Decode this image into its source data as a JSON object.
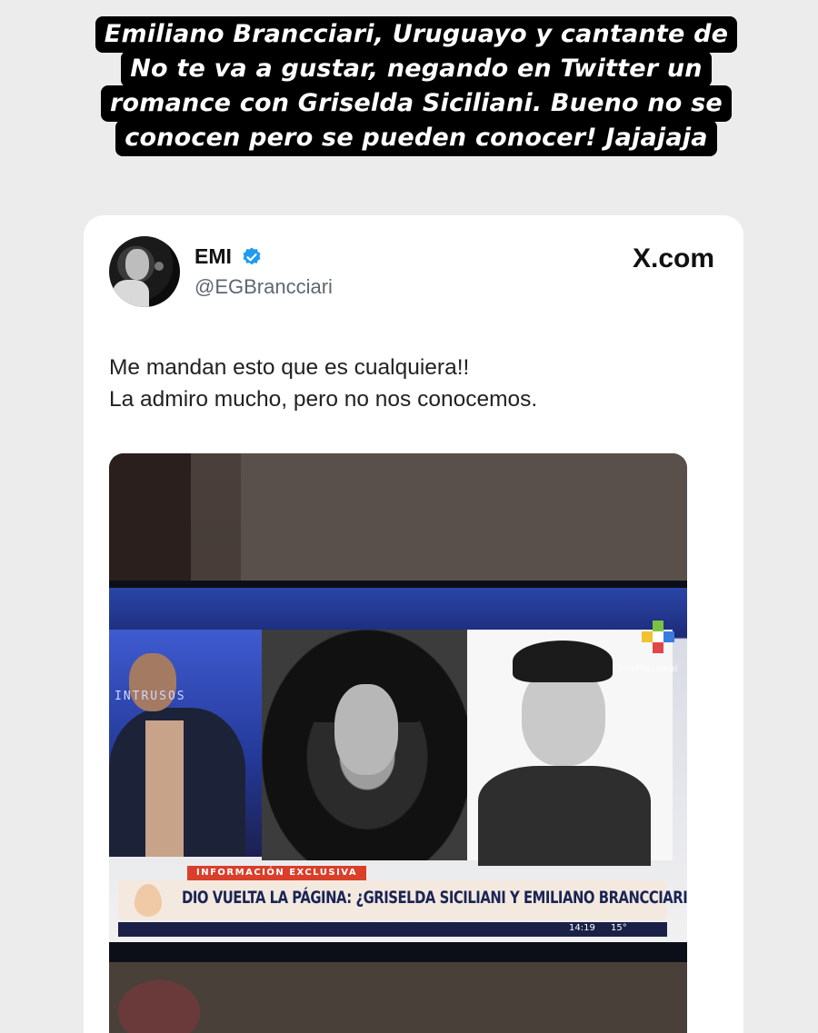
{
  "caption": {
    "lines": [
      "Emiliano Brancciari, Uruguayo y cantante de",
      "No te va a gustar, negando en Twitter un",
      "romance con Griselda Siciliani. Bueno no se",
      "conocen pero se pueden conocer! Jajajaja"
    ]
  },
  "tweet": {
    "display_name": "EMI",
    "handle": "@EGBrancciari",
    "brand": "X.com",
    "text_lines": [
      "Me mandan esto que  es cualquiera!!",
      "La admiro mucho, pero no nos conocemos."
    ]
  },
  "tv": {
    "show_logo": "INTRUSOS",
    "channel_label": "Internacional",
    "ticker_tag": "INFORMACIÓN EXCLUSIVA",
    "ticker_text": "DIO VUELTA LA PÁGINA: ¿GRISELDA SICILIANI Y EMILIANO BRANCCIARI?",
    "time": "14:19",
    "temp": "15°"
  },
  "colors": {
    "background": "#ececec",
    "caption_bg": "#000000",
    "verified": "#1d9bf0",
    "ticker_tag": "#d93f2a",
    "ticker_text": "#1a2555"
  },
  "icons": {
    "verified": "verified-badge-icon",
    "brand": "x-logo"
  }
}
